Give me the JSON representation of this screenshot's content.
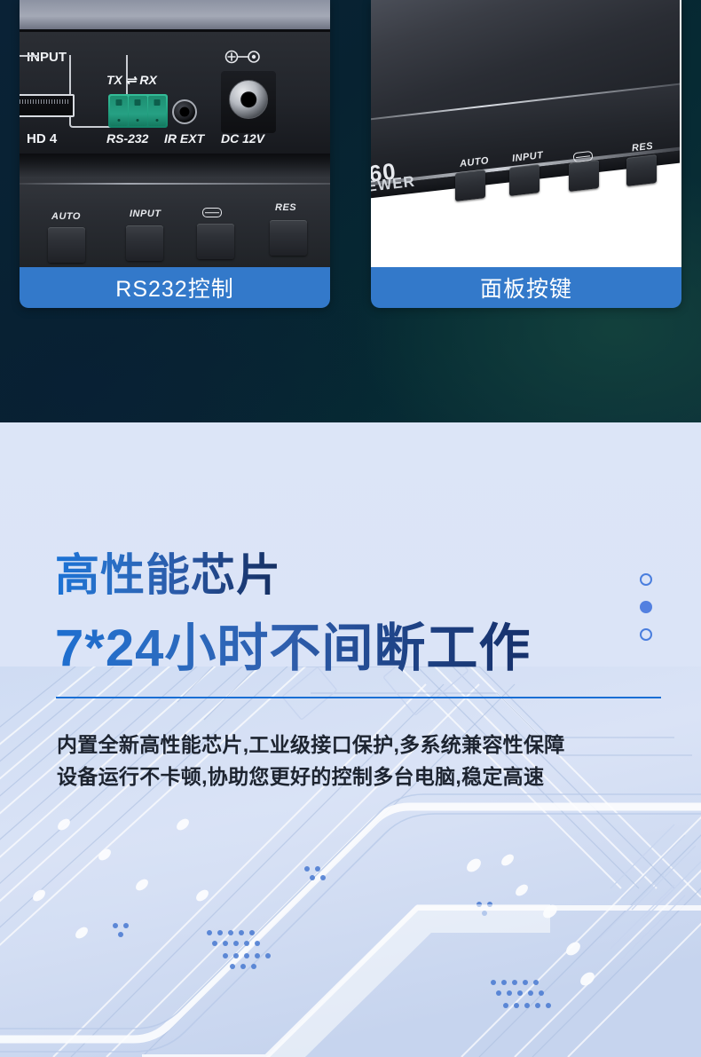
{
  "page": {
    "background_dark": "#072231",
    "background_light": "#dbe4f7",
    "accent_blue": "#3379ca",
    "headline_blue": "#1a72d6",
    "headline_navy": "#142d5e"
  },
  "gallery": {
    "cards": [
      {
        "id": "rs232",
        "caption": "RS232控制",
        "photo_labels": {
          "input": "INPUT",
          "hd4": "HD 4",
          "txrx": "TX ⇌ RX",
          "rs232": "RS-232",
          "ir": "IR EXT",
          "dc": "DC 12V",
          "keys": [
            "AUTO",
            "INPUT",
            "",
            "RES"
          ]
        }
      },
      {
        "id": "panel",
        "caption": "面板按键",
        "photo_labels": {
          "brand_line1": "60",
          "brand_line2": "EWER",
          "keys": [
            "AUTO",
            "INPUT",
            "",
            "RES"
          ]
        }
      }
    ]
  },
  "feature": {
    "headline_line1": "高性能芯片",
    "headline_line2": "7*24小时不间断工作",
    "body_line1": "内置全新高性能芯片,工业级接口保护,多系统兼容性保障",
    "body_line2": "设备运行不卡顿,协助您更好的控制多台电脑,稳定高速",
    "dots": [
      "hollow",
      "solid",
      "hollow"
    ]
  }
}
